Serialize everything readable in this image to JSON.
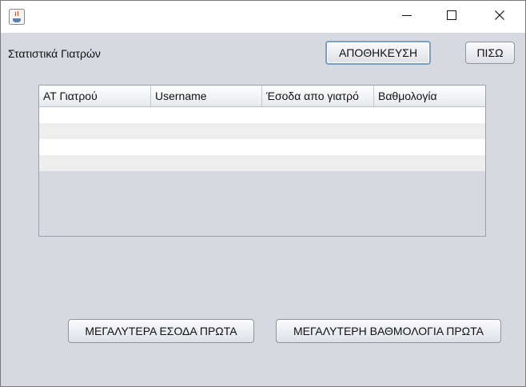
{
  "window": {
    "title": "",
    "controls": [
      "minimize-icon",
      "maximize-icon",
      "close-icon"
    ]
  },
  "header": {
    "label": "Στατιστικά Γιατρών",
    "save_button": "ΑΠΟΘΗΚΕΥΣΗ",
    "back_button": "ΠΙΣΩ"
  },
  "table": {
    "columns": [
      "ΑΤ Γιατρού",
      "Username",
      "Έσοδα απο γιατρό",
      "Βαθμολογία"
    ],
    "rows": [
      [
        "",
        "",
        "",
        ""
      ],
      [
        "",
        "",
        "",
        ""
      ],
      [
        "",
        "",
        "",
        ""
      ],
      [
        "",
        "",
        "",
        ""
      ]
    ]
  },
  "actions": {
    "sort_income": "ΜΕΓΑΛΥΤΕΡΑ ΕΣΟΔΑ ΠΡΩΤΑ",
    "sort_rating": "ΜΕΓΑΛΥΤΕΡΗ ΒΑΘΜΟΛΟΓΙΑ ΠΡΩΤΑ"
  },
  "colors": {
    "background": "#d6d9df",
    "row_white": "#ffffff",
    "row_alt": "#eeeeee"
  }
}
